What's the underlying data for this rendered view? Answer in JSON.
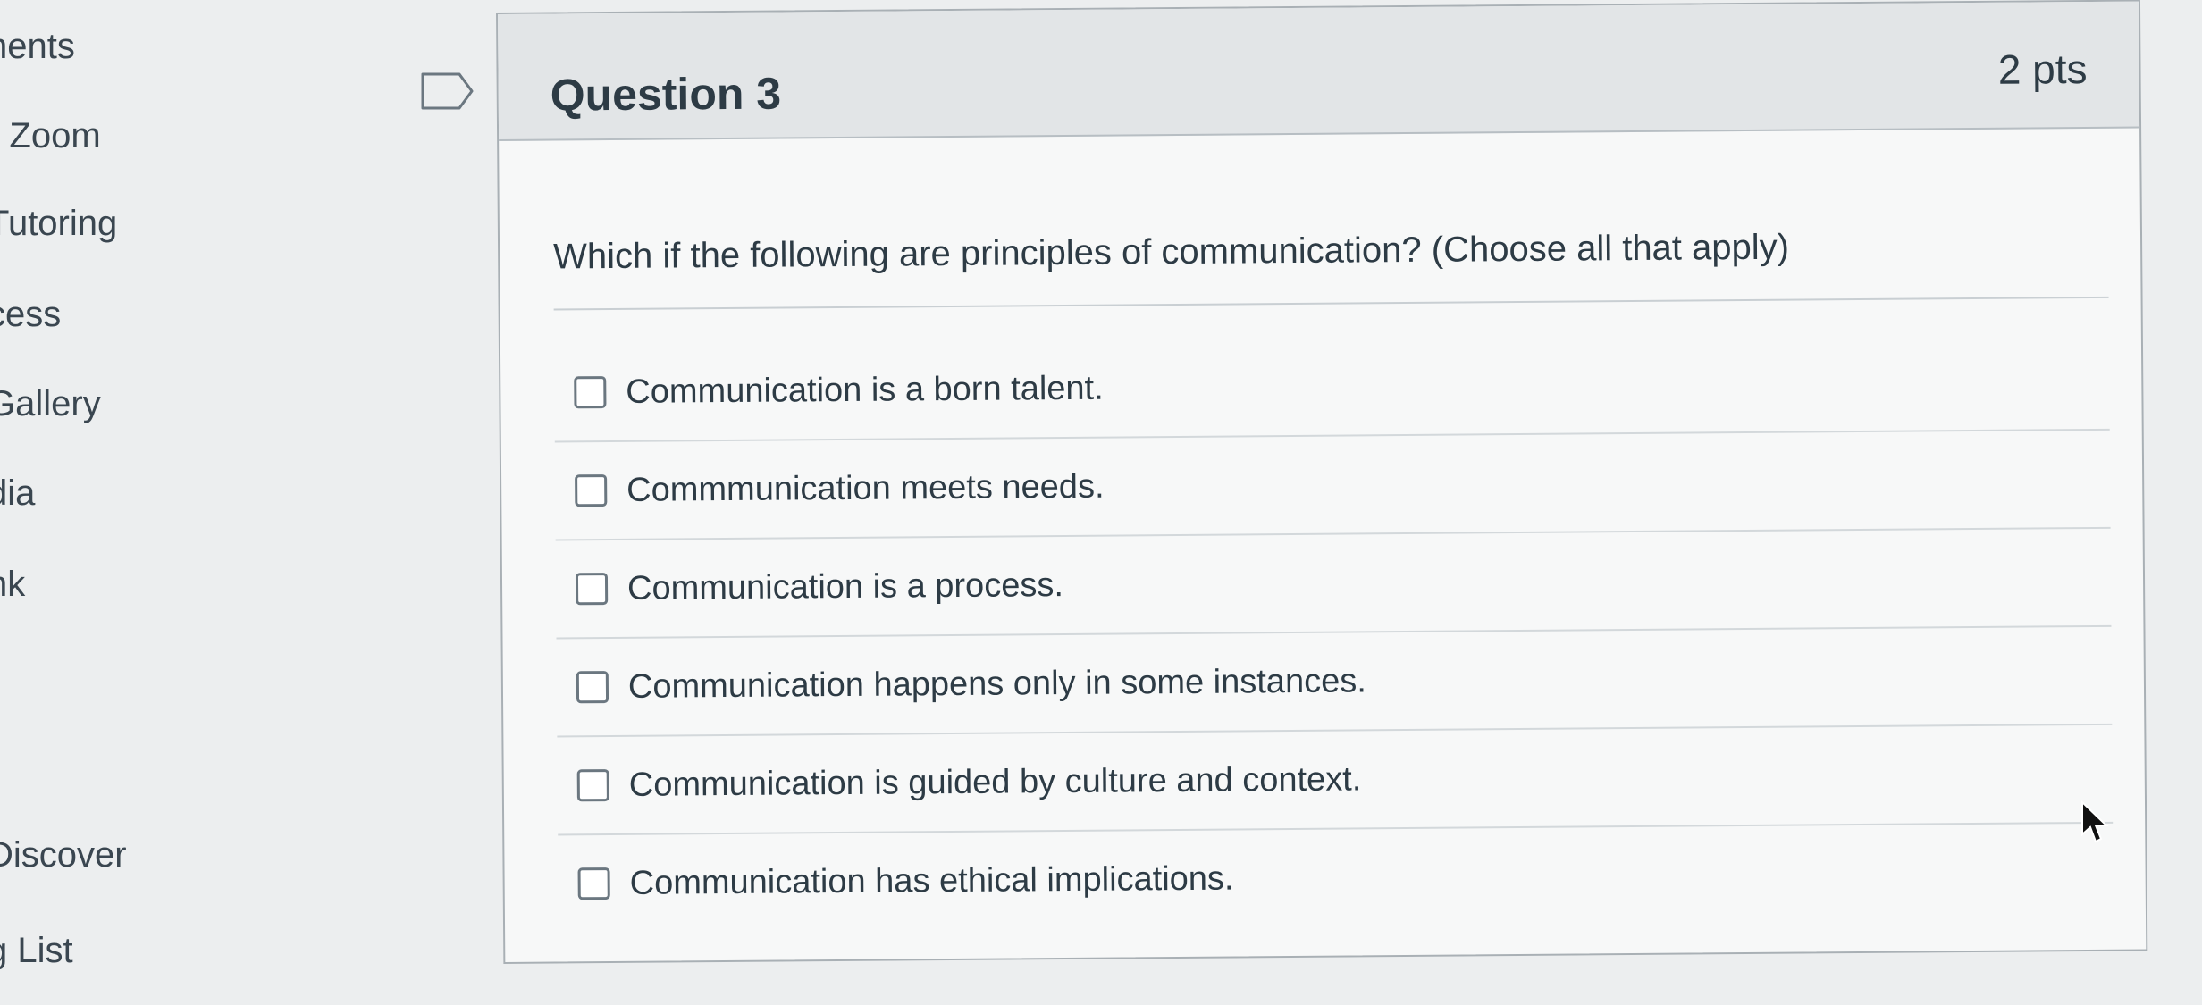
{
  "sidebar": {
    "items": [
      {
        "label": "nents"
      },
      {
        "label": "r Zoom"
      },
      {
        "label": "Tutoring"
      },
      {
        "label": "cess"
      },
      {
        "label": "Gallery"
      },
      {
        "label": "dia"
      },
      {
        "label": "nk"
      },
      {
        "label": "Discover"
      },
      {
        "label": "g List"
      }
    ]
  },
  "question": {
    "title": "Question 3",
    "points": "2 pts",
    "text": "Which if the following are principles of communication? (Choose all that apply)",
    "answers": [
      {
        "label": "Communication is a born talent.",
        "checked": false
      },
      {
        "label": "Commmunication meets needs.",
        "checked": false
      },
      {
        "label": "Communication is a process.",
        "checked": false
      },
      {
        "label": "Communication happens only in some instances.",
        "checked": false
      },
      {
        "label": "Communication is guided by culture and context.",
        "checked": false
      },
      {
        "label": "Communication has ethical implications.",
        "checked": false
      }
    ]
  },
  "colors": {
    "background": "#eceeef",
    "card": "#f7f8f8",
    "header": "#e2e5e7",
    "text": "#2d3b45"
  },
  "icons": [
    "flag-icon",
    "checkbox-icon",
    "mouse-cursor-icon"
  ]
}
